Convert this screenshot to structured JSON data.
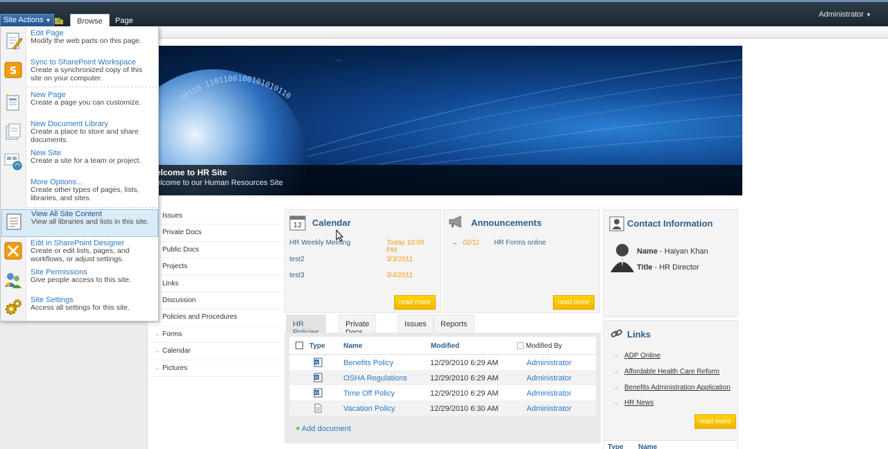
{
  "ribbon": {
    "site_actions": "Site Actions",
    "tabs": [
      "Browse",
      "Page"
    ],
    "user": "Administrator"
  },
  "banner": {
    "title": "elcome to HR Site",
    "subtitle": "elcome to our Human Resources Site",
    "binary": "00110 1101100100101010110"
  },
  "quicklaunch": [
    "Issues",
    "Private Docs",
    "Public Docs",
    "Projects",
    "Links",
    "Discussion",
    "Policies and Procedures",
    "Forms",
    "Calendar",
    "Pictures"
  ],
  "calendar": {
    "title": "Calendar",
    "icon_text": "12",
    "events": [
      {
        "name": "HR Weekly Meeting",
        "date": "Today 10:00 PM"
      },
      {
        "name": "test2",
        "date": "3/3/2011"
      },
      {
        "name": "test3",
        "date": "3/4/2011"
      }
    ],
    "read_more": "read more"
  },
  "announcements": {
    "title": "Announcements",
    "items": [
      {
        "date": "02/11",
        "title": "HR Forms online"
      }
    ],
    "read_more": "read more"
  },
  "contact": {
    "title": "Contact Information",
    "name_label": "Name",
    "name": "Haiyan Khan",
    "title_label": "Title",
    "job_title": "HR Director"
  },
  "links": {
    "title": "Links",
    "items": [
      "ADP Online",
      "Affordable Health Care Reform",
      "Benefits Administration Application",
      "HR News"
    ],
    "read_more": "read more",
    "footer_cols": [
      "Type",
      "Name"
    ]
  },
  "doclib": {
    "tabs": [
      "HR Policies",
      "Private Docs",
      "Issues",
      "Reports"
    ],
    "columns": {
      "type": "Type",
      "name": "Name",
      "modified": "Modified",
      "modified_by": "Modified By"
    },
    "rows": [
      {
        "name": "Benefits Policy",
        "modified": "12/29/2010 6:29 AM",
        "by": "Administrator",
        "icon": "word-doc-icon"
      },
      {
        "name": "OSHA Regulations",
        "modified": "12/29/2010 6:29 AM",
        "by": "Administrator",
        "icon": "word-doc-icon"
      },
      {
        "name": "Time Off Policy",
        "modified": "12/29/2010 6:29 AM",
        "by": "Administrator",
        "icon": "word-doc-icon"
      },
      {
        "name": "Vacation Policy",
        "modified": "12/29/2010 6:30 AM",
        "by": "Administrator",
        "icon": "text-doc-icon"
      }
    ],
    "add": "Add document"
  },
  "menu": [
    {
      "title": "Edit Page",
      "desc": "Modify the web parts on this page.",
      "icon": "edit-page-icon"
    },
    {
      "title": "Sync to SharePoint Workspace",
      "desc": "Create a synchronized copy of this site on your computer.",
      "icon": "workspace-icon"
    },
    {
      "title": "New Page",
      "desc": "Create a page you can customize.",
      "icon": "new-page-icon"
    },
    {
      "title": "New Document Library",
      "desc": "Create a place to store and share documents.",
      "icon": "doc-library-icon"
    },
    {
      "title": "New Site",
      "desc": "Create a site for a team or project.",
      "icon": "new-site-icon"
    },
    {
      "title": "More Options...",
      "desc": "Create other types of pages, lists, libraries, and sites.",
      "icon": "more-options-icon"
    },
    {
      "title": "View All Site Content",
      "desc": "View all libraries and lists in this site.",
      "icon": "site-content-icon"
    },
    {
      "title": "Edit in SharePoint Designer",
      "desc": "Create or edit lists, pages, and workflows, or adjust settings.",
      "icon": "designer-icon"
    },
    {
      "title": "Site Permissions",
      "desc": "Give people access to this site.",
      "icon": "permissions-icon"
    },
    {
      "title": "Site Settings",
      "desc": "Access all settings for this site.",
      "icon": "settings-icon"
    }
  ]
}
